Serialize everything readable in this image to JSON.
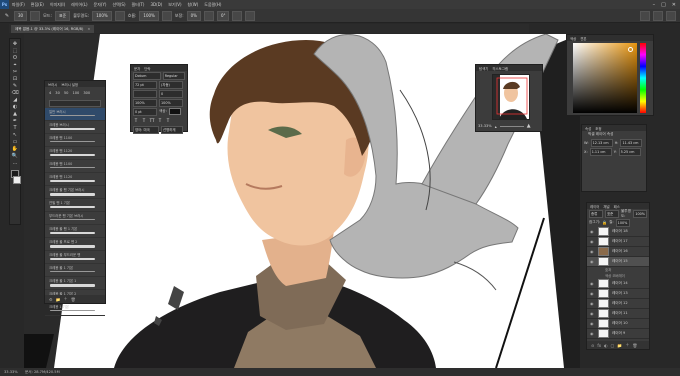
{
  "app": {
    "logo": "Ps"
  },
  "menu": [
    "파일(F)",
    "편집(E)",
    "이미지(I)",
    "레이어(L)",
    "문자(Y)",
    "선택(S)",
    "필터(T)",
    "3D(D)",
    "보기(V)",
    "창(W)",
    "도움말(H)"
  ],
  "window_controls": [
    "–",
    "□",
    "✕"
  ],
  "options": {
    "size": "30",
    "mode_label": "모드:",
    "mode": "표준",
    "opacity_label": "불투명도:",
    "opacity": "100%",
    "flow_label": "흐름:",
    "flow": "100%",
    "smooth_label": "보정:",
    "smooth": "0%",
    "angle": "0°"
  },
  "doc_tab": {
    "title": "제목 없음-1 @ 33.3% (레이어 16, RGB/8)",
    "close": "×"
  },
  "tools": [
    "✥",
    "⬚",
    "ʘ",
    "⌖",
    "✂",
    "⊡",
    "✎",
    "⌫",
    "◢",
    "◐",
    "▲",
    "✒",
    "T",
    "↖",
    "▭",
    "✋",
    "🔍",
    "…"
  ],
  "brush_panel": {
    "tabs": [
      "브러시",
      "브러시 설정"
    ],
    "sizes": [
      "4",
      "30",
      "50",
      "100",
      "300"
    ],
    "items": [
      "일반 브러시",
      "크레용 브러시",
      "크레용 펜 1100",
      "크레용 펜 1120",
      "크레용 펜 1100",
      "크레용 펜 1120",
      "크레용 올 펜 기본 브러시",
      "연필 펜 1 기본",
      "부드러운 펜 기본 브러시",
      "크레용 올 펜 1 기본",
      "크레용 올 프로 펜 2",
      "크레용 올 부드러운 펜",
      "크레용 올 1 기본",
      "크레용 올 1 기본 1",
      "크레용 올 1 기본 2",
      "크레용 1 기본",
      "브러시 기본"
    ],
    "footer": [
      "⚙",
      "📁",
      "＋",
      "🗑"
    ]
  },
  "char_panel": {
    "tabs": [
      "문자",
      "단락"
    ],
    "font": "Dotum",
    "style": "Regular",
    "size": "72 pt",
    "leading": "(자동)",
    "tracking": "0",
    "scale_v": "100%",
    "scale_h": "100%",
    "baseline": "0 pt",
    "color_label": "색상:",
    "lang": "영어: 미국",
    "aa": "선명하게"
  },
  "navigator": {
    "tabs": [
      "탐색기",
      "히스토그램"
    ],
    "zoom": "33.33%"
  },
  "color_panel": {
    "tabs": [
      "색상",
      "견본"
    ],
    "accent": "#e8950f"
  },
  "props_panel": {
    "tabs": [
      "속성",
      "조정"
    ],
    "title": "픽셀 레이어 속성",
    "w_label": "W:",
    "w": "12.13 cm",
    "h_label": "H:",
    "h": "11.43 cm",
    "x_label": "X:",
    "x": "1.11 cm",
    "y_label": "Y:",
    "y": "5.25 cm"
  },
  "layers_panel": {
    "tabs": [
      "레이어",
      "채널",
      "패스"
    ],
    "kind": "종류",
    "blend": "표준",
    "opacity_label": "불투명도:",
    "opacity": "100%",
    "lock_label": "잠그기:",
    "fill_label": "칠:",
    "fill": "100%",
    "layers": [
      {
        "name": "레이어 18",
        "active": false
      },
      {
        "name": "레이어 17",
        "active": false
      },
      {
        "name": "레이어 16",
        "active": false
      },
      {
        "name": "레이어 15",
        "active": true
      },
      {
        "name": "레이어 14",
        "active": false
      },
      {
        "name": "레이어 13",
        "active": false
      },
      {
        "name": "레이어 12",
        "active": false
      },
      {
        "name": "레이어 11",
        "active": false
      },
      {
        "name": "레이어 10",
        "active": false
      },
      {
        "name": "레이어 9",
        "active": false
      }
    ],
    "sub_items": [
      "효과",
      "색상 오버레이"
    ],
    "footer": [
      "⊝",
      "fx",
      "◐",
      "▢",
      "📁",
      "＋",
      "🗑"
    ]
  },
  "status": {
    "zoom": "33.33%",
    "info": "문서: 28.7M/420.5M"
  }
}
